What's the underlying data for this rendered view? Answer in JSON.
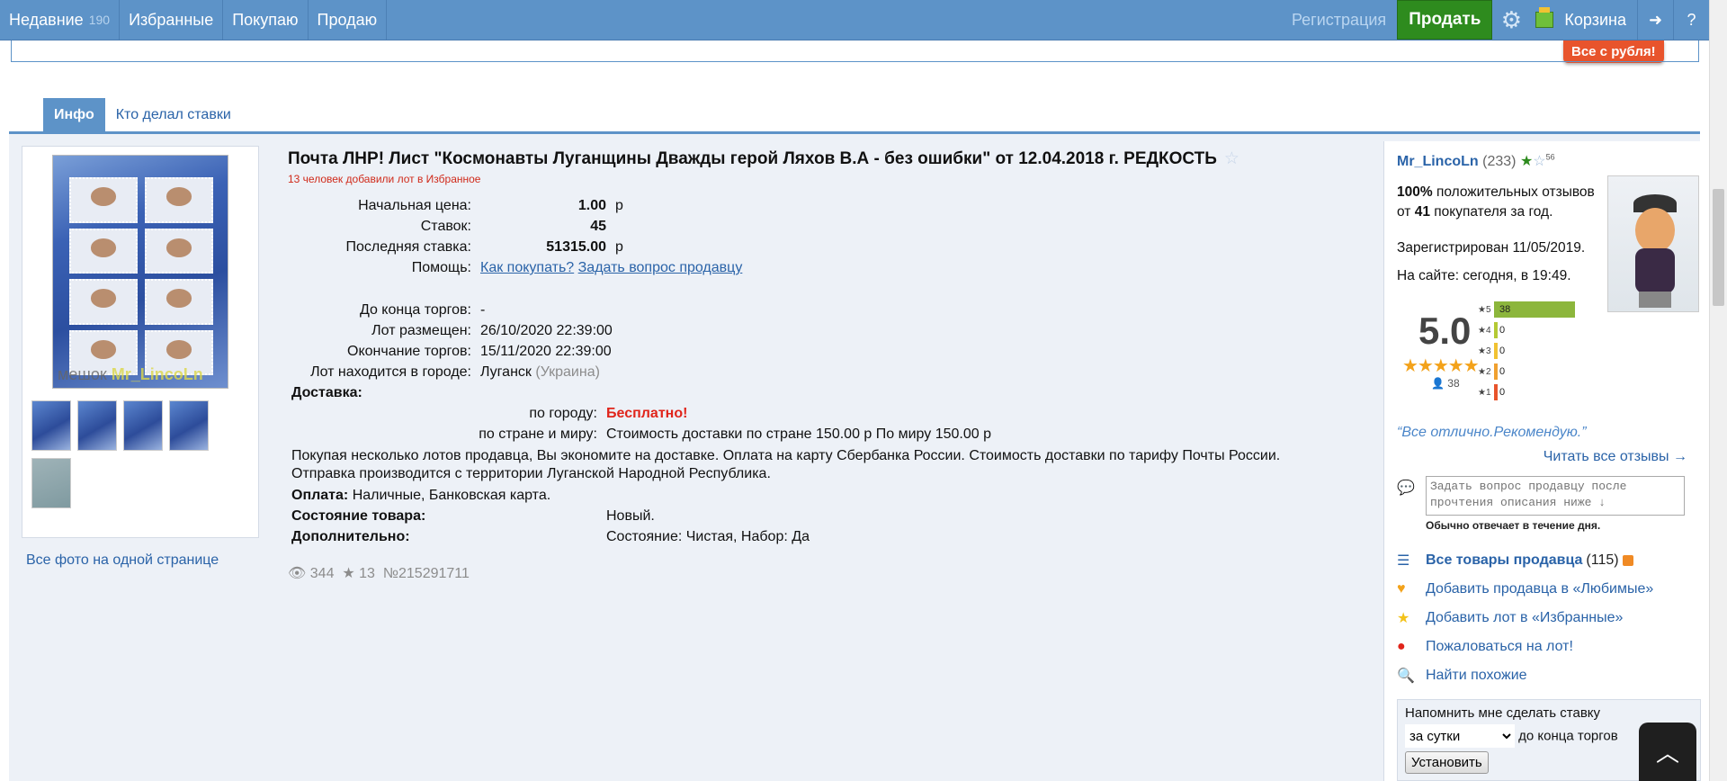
{
  "topbar": {
    "recent_label": "Недавние",
    "recent_count": "190",
    "favorites_label": "Избранные",
    "buying_label": "Покупаю",
    "selling_label": "Продаю",
    "register_label": "Регистрация",
    "sell_button": "Продать",
    "cart_label": "Корзина"
  },
  "promo_label": "Все с рубля!",
  "tabs": [
    "Инфо",
    "Кто делал ставки"
  ],
  "gallery": {
    "all_photos_link": "Все фото на одной странице",
    "watermark_prefix": "мешок",
    "watermark_user": "Mr_LincoLn"
  },
  "lot": {
    "title": "Почта ЛНР! Лист \"Космонавты Луганщины Дважды герой Ляхов В.А - без ошибки\" от 12.04.2018 г. РЕДКОСТЬ",
    "favorites_note": "13 человек добавили лот в Избранное",
    "start_price_label": "Начальная цена:",
    "start_price": "1.00",
    "currency": "р",
    "bids_label": "Ставок:",
    "bids": "45",
    "last_bid_label": "Последняя ставка:",
    "last_bid": "51315.00",
    "help_label": "Помощь:",
    "help_how_to_buy": "Как покупать?",
    "help_ask_seller": "Задать вопрос продавцу",
    "end_in_label": "До конца торгов:",
    "end_in": "-",
    "placed_label": "Лот размещен:",
    "placed": "26/10/2020 22:39:00",
    "ends_label": "Окончание торгов:",
    "ends": "15/11/2020 22:39:00",
    "city_label": "Лот находится в городе:",
    "city": "Луганск",
    "country": "(Украина)",
    "delivery_label": "Доставка:",
    "delivery_city_label": "по городу:",
    "delivery_city": "Бесплатно!",
    "delivery_world_label": "по стране и миру:",
    "delivery_world": "Стоимость доставки по стране 150.00 р По миру 150.00 р",
    "delivery_note": "Покупая несколько лотов продавца, Вы экономите на доставке. Оплата на карту Сбербанка России. Стоимость доставки по тарифу Почты России. Отправка производится с территории Луганской Народной Республика.",
    "payment_label": "Оплата:",
    "payment": "Наличные, Банковская карта.",
    "condition_label": "Состояние товара:",
    "condition": "Новый.",
    "extra_label": "Дополнительно:",
    "extra": "Состояние: Чистая, Набор: Да",
    "views": "344",
    "stars": "13",
    "lot_number": "№215291711"
  },
  "seller": {
    "name": "Mr_LincoLn",
    "count": "(233)",
    "small_num": "56",
    "positive_pct": "100%",
    "positive_text_1": "положительных отзывов от",
    "positive_buyers": "41",
    "positive_text_2": "покупателя за год.",
    "registered": "Зарегистрирован 11/05/2019.",
    "online": "На сайте: сегодня, в 19:49.",
    "score": "5.0",
    "reviews_count": "38",
    "ratings": [
      {
        "stars": "5",
        "count": "38",
        "fraction": 1.0,
        "color": "#8cb63c"
      },
      {
        "stars": "4",
        "count": "0",
        "fraction": 0,
        "color": "#b4c934"
      },
      {
        "stars": "3",
        "count": "0",
        "fraction": 0,
        "color": "#f1c232"
      },
      {
        "stars": "2",
        "count": "0",
        "fraction": 0,
        "color": "#f0a030"
      },
      {
        "stars": "1",
        "count": "0",
        "fraction": 0,
        "color": "#e8542c"
      }
    ],
    "quote": "“Все отлично.Рекомендую.”",
    "read_all": "Читать все отзывы →",
    "ask_placeholder": "Задать вопрос продавцу после прочтения описания ниже ↓",
    "answers_note": "Обычно отвечает в течение дня.",
    "all_items_label": "Все товары продавца",
    "all_items_count": "(115)",
    "add_favorite_seller": "Добавить продавца в «Любимые»",
    "add_favorite_lot": "Добавить лот в «Избранные»",
    "complain": "Пожаловаться на лот!",
    "find_similar": "Найти похожие"
  },
  "reminder": {
    "label": "Напомнить мне сделать ставку",
    "option": "за сутки",
    "suffix": "до конца торгов",
    "button": "Установить"
  },
  "colors": {
    "topbar": "#5d93c8",
    "sell": "#2e8b1e",
    "promo": "#e8542c",
    "link": "#2a63a8",
    "red": "#e0251b"
  }
}
